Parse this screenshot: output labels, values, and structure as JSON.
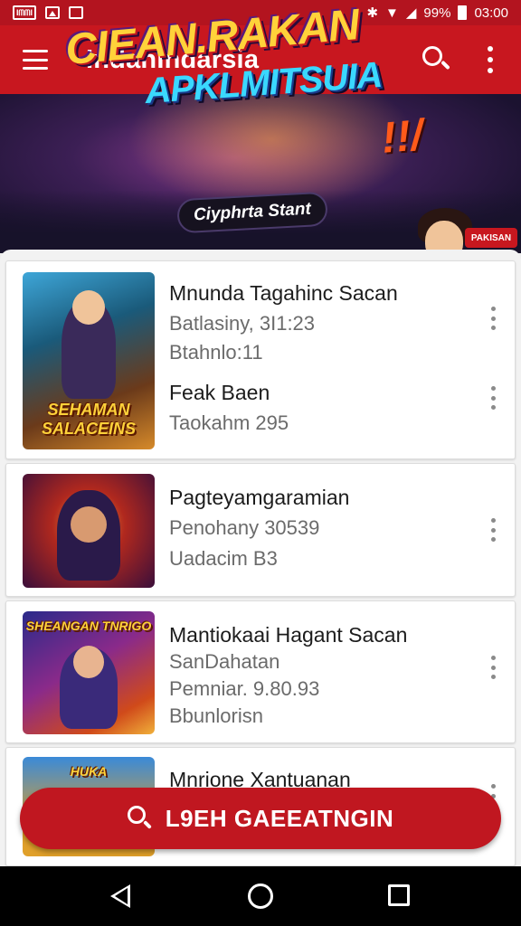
{
  "status_bar": {
    "left_badge": "IᗰᗰI",
    "battery_percent": "99%",
    "time": "03:00"
  },
  "app_bar": {
    "title": "IndanIndarsia",
    "search_icon": "search-icon",
    "more_icon": "more-vert-icon",
    "menu_icon": "menu-icon"
  },
  "banner": {
    "headline_line1": "CIEAN.RAKAN",
    "headline_line2": "APKLMITSUIA",
    "exclaim": "!!/",
    "tag": "Ciyphrta Stant",
    "badge": "PAKISAN"
  },
  "items": [
    {
      "title": "Mnunda Tagahinc Sacan",
      "sub1": "Batlasiny, 3I1:23",
      "sub2": "Btahnlo:11",
      "title2": "Feak Baen",
      "sub3": "Taokahm 295",
      "thumb_label": "SEHAMAN SALACEINS"
    },
    {
      "title": "Pagteyamgaramian",
      "sub1": "Penohany 30539",
      "sub2": "Uadacim B3"
    },
    {
      "title": "Mantiokaai Hagant Sacan",
      "sub1": "SanDahatan",
      "sub2": "Pemniar. 9.80.93",
      "sub3": "Bbunlorisn",
      "thumb_label": "SHEANGAN TNRIGO"
    },
    {
      "title": "Mnrione Xantuanan",
      "thumb_label": "HUKA"
    }
  ],
  "cta": {
    "label": "L9EH GAEEATNGIN",
    "icon": "search-icon"
  },
  "colors": {
    "primary": "#c8171f",
    "statusbar": "#b3141f",
    "text_primary": "#1c1c1c",
    "text_secondary": "#6b6b6b"
  }
}
